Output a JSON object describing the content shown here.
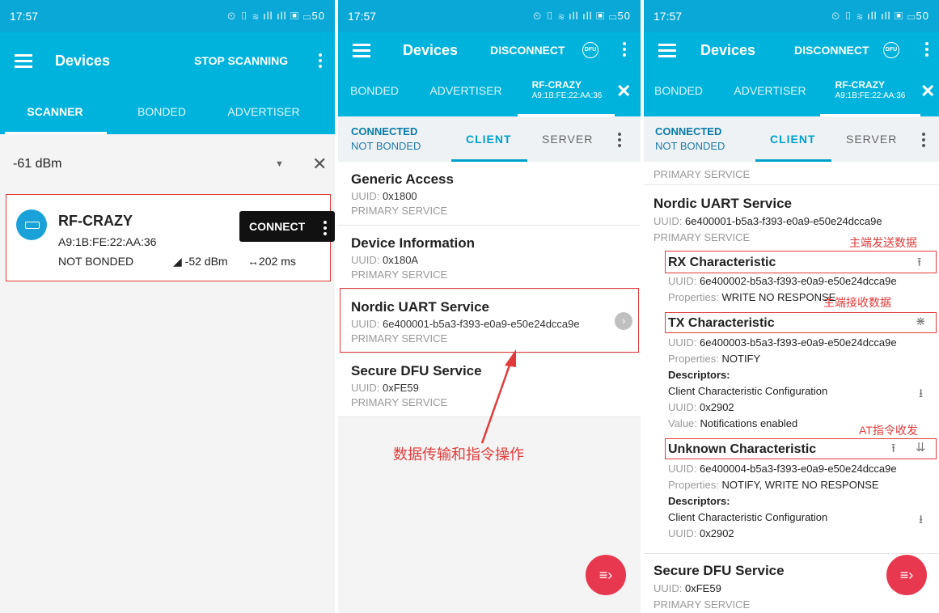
{
  "status_bar": {
    "time": "17:57",
    "icons": "⏲ ▯ ≋ ıll ıll ▣ ▭50"
  },
  "panel1": {
    "app_title": "Devices",
    "action": "STOP SCANNING",
    "tabs": [
      "SCANNER",
      "BONDED",
      "ADVERTISER"
    ],
    "filter_value": "-61 dBm",
    "device": {
      "name": "RF-CRAZY",
      "mac": "A9:1B:FE:22:AA:36",
      "bond": "NOT BONDED",
      "rssi": "◢ -52 dBm",
      "interval": "↔202 ms",
      "connect_label": "CONNECT"
    }
  },
  "panel2": {
    "app_title": "Devices",
    "action": "DISCONNECT",
    "dfu_label": "DFU",
    "tabs": [
      "BONDED",
      "ADVERTISER"
    ],
    "active_device_name": "RF-CRAZY",
    "active_device_mac": "A9:1B:FE:22:AA:36",
    "conn_state": "CONNECTED",
    "bond_state": "NOT BONDED",
    "client_tab": "CLIENT",
    "server_tab": "SERVER",
    "services": [
      {
        "name": "Generic Access",
        "uuid_label": "UUID:",
        "uuid": "0x1800",
        "type": "PRIMARY SERVICE"
      },
      {
        "name": "Device Information",
        "uuid_label": "UUID:",
        "uuid": "0x180A",
        "type": "PRIMARY SERVICE"
      },
      {
        "name": "Nordic UART Service",
        "uuid_label": "UUID:",
        "uuid": "6e400001-b5a3-f393-e0a9-e50e24dcca9e",
        "type": "PRIMARY SERVICE"
      },
      {
        "name": "Secure DFU Service",
        "uuid_label": "UUID:",
        "uuid": "0xFE59",
        "type": "PRIMARY SERVICE"
      }
    ],
    "annotation": "数据传输和指令操作"
  },
  "panel3": {
    "app_title": "Devices",
    "action": "DISCONNECT",
    "dfu_label": "DFU",
    "tabs": [
      "BONDED",
      "ADVERTISER"
    ],
    "active_device_name": "RF-CRAZY",
    "active_device_mac": "A9:1B:FE:22:AA:36",
    "conn_state": "CONNECTED",
    "bond_state": "NOT BONDED",
    "client_tab": "CLIENT",
    "server_tab": "SERVER",
    "top_type": "PRIMARY SERVICE",
    "service_name": "Nordic UART Service",
    "service_uuid_label": "UUID:",
    "service_uuid": "6e400001-b5a3-f393-e0a9-e50e24dcca9e",
    "service_type": "PRIMARY SERVICE",
    "rx": {
      "annotation": "主端发送数据",
      "name": "RX Characteristic",
      "uuid_label": "UUID:",
      "uuid": "6e400002-b5a3-f393-e0a9-e50e24dcca9e",
      "props_label": "Properties:",
      "props": "WRITE NO RESPONSE"
    },
    "tx": {
      "annotation": "主端接收数据",
      "name": "TX Characteristic",
      "uuid_label": "UUID:",
      "uuid": "6e400003-b5a3-f393-e0a9-e50e24dcca9e",
      "props_label": "Properties:",
      "props": "NOTIFY",
      "descriptors_label": "Descriptors:",
      "descriptor_name": "Client Characteristic Configuration",
      "descriptor_uuid_label": "UUID:",
      "descriptor_uuid": "0x2902",
      "value_label": "Value:",
      "value": "Notifications enabled"
    },
    "unknown": {
      "annotation": "AT指令收发",
      "name": "Unknown Characteristic",
      "uuid_label": "UUID:",
      "uuid": "6e400004-b5a3-f393-e0a9-e50e24dcca9e",
      "props_label": "Properties:",
      "props": "NOTIFY, WRITE NO RESPONSE",
      "descriptors_label": "Descriptors:",
      "descriptor_name": "Client Characteristic Configuration",
      "descriptor_uuid_label": "UUID:",
      "descriptor_uuid": "0x2902"
    },
    "next_service": {
      "name": "Secure DFU Service",
      "uuid_label": "UUID:",
      "uuid": "0xFE59",
      "type": "PRIMARY SERVICE"
    }
  },
  "colors": {
    "accent": "#00b3dc",
    "status": "#0aa8d6",
    "annotation": "#e23b3b",
    "fab": "#e8384f"
  }
}
